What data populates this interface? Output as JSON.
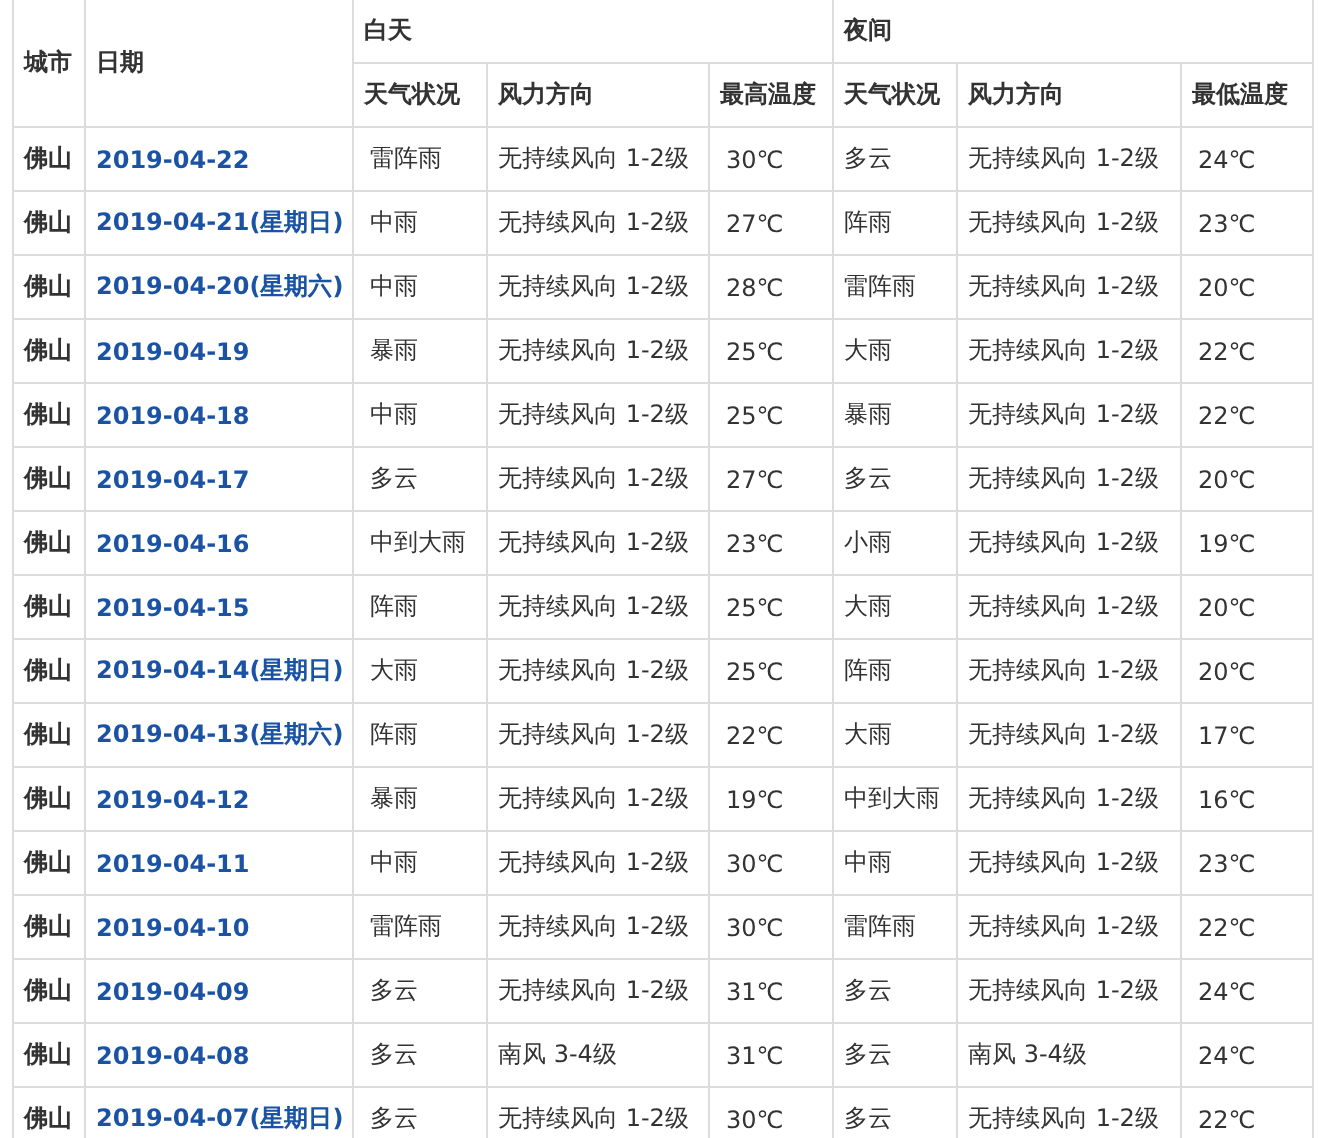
{
  "table": {
    "headers": {
      "city": "城市",
      "date": "日期",
      "day": "白天",
      "night": "夜间",
      "day_columns": [
        "天气状况",
        "风力方向",
        "最高温度"
      ],
      "night_columns": [
        "天气状况",
        "风力方向",
        "最低温度"
      ]
    },
    "rows": [
      {
        "city": "佛山",
        "date": "2019-04-22",
        "day": [
          "雷阵雨",
          "无持续风向 1-2级",
          "30℃"
        ],
        "night": [
          "多云",
          "无持续风向 1-2级",
          "24℃"
        ]
      },
      {
        "city": "佛山",
        "date": "2019-04-21(星期日)",
        "day": [
          "中雨",
          "无持续风向 1-2级",
          "27℃"
        ],
        "night": [
          "阵雨",
          "无持续风向 1-2级",
          "23℃"
        ]
      },
      {
        "city": "佛山",
        "date": "2019-04-20(星期六)",
        "day": [
          "中雨",
          "无持续风向 1-2级",
          "28℃"
        ],
        "night": [
          "雷阵雨",
          "无持续风向 1-2级",
          "20℃"
        ]
      },
      {
        "city": "佛山",
        "date": "2019-04-19",
        "day": [
          "暴雨",
          "无持续风向 1-2级",
          "25℃"
        ],
        "night": [
          "大雨",
          "无持续风向 1-2级",
          "22℃"
        ]
      },
      {
        "city": "佛山",
        "date": "2019-04-18",
        "day": [
          "中雨",
          "无持续风向 1-2级",
          "25℃"
        ],
        "night": [
          "暴雨",
          "无持续风向 1-2级",
          "22℃"
        ]
      },
      {
        "city": "佛山",
        "date": "2019-04-17",
        "day": [
          "多云",
          "无持续风向 1-2级",
          "27℃"
        ],
        "night": [
          "多云",
          "无持续风向 1-2级",
          "20℃"
        ]
      },
      {
        "city": "佛山",
        "date": "2019-04-16",
        "day": [
          "中到大雨",
          "无持续风向 1-2级",
          "23℃"
        ],
        "night": [
          "小雨",
          "无持续风向 1-2级",
          "19℃"
        ]
      },
      {
        "city": "佛山",
        "date": "2019-04-15",
        "day": [
          "阵雨",
          "无持续风向 1-2级",
          "25℃"
        ],
        "night": [
          "大雨",
          "无持续风向 1-2级",
          "20℃"
        ]
      },
      {
        "city": "佛山",
        "date": "2019-04-14(星期日)",
        "day": [
          "大雨",
          "无持续风向 1-2级",
          "25℃"
        ],
        "night": [
          "阵雨",
          "无持续风向 1-2级",
          "20℃"
        ]
      },
      {
        "city": "佛山",
        "date": "2019-04-13(星期六)",
        "day": [
          "阵雨",
          "无持续风向 1-2级",
          "22℃"
        ],
        "night": [
          "大雨",
          "无持续风向 1-2级",
          "17℃"
        ]
      },
      {
        "city": "佛山",
        "date": "2019-04-12",
        "day": [
          "暴雨",
          "无持续风向 1-2级",
          "19℃"
        ],
        "night": [
          "中到大雨",
          "无持续风向 1-2级",
          "16℃"
        ]
      },
      {
        "city": "佛山",
        "date": "2019-04-11",
        "day": [
          "中雨",
          "无持续风向 1-2级",
          "30℃"
        ],
        "night": [
          "中雨",
          "无持续风向 1-2级",
          "23℃"
        ]
      },
      {
        "city": "佛山",
        "date": "2019-04-10",
        "day": [
          "雷阵雨",
          "无持续风向 1-2级",
          "30℃"
        ],
        "night": [
          "雷阵雨",
          "无持续风向 1-2级",
          "22℃"
        ]
      },
      {
        "city": "佛山",
        "date": "2019-04-09",
        "day": [
          "多云",
          "无持续风向 1-2级",
          "31℃"
        ],
        "night": [
          "多云",
          "无持续风向 1-2级",
          "24℃"
        ]
      },
      {
        "city": "佛山",
        "date": "2019-04-08",
        "day": [
          "多云",
          "南风 3-4级",
          "31℃"
        ],
        "night": [
          "多云",
          "南风 3-4级",
          "24℃"
        ]
      },
      {
        "city": "佛山",
        "date": "2019-04-07(星期日)",
        "day": [
          "多云",
          "无持续风向 1-2级",
          "30℃"
        ],
        "night": [
          "多云",
          "无持续风向 1-2级",
          "22℃"
        ]
      }
    ]
  }
}
